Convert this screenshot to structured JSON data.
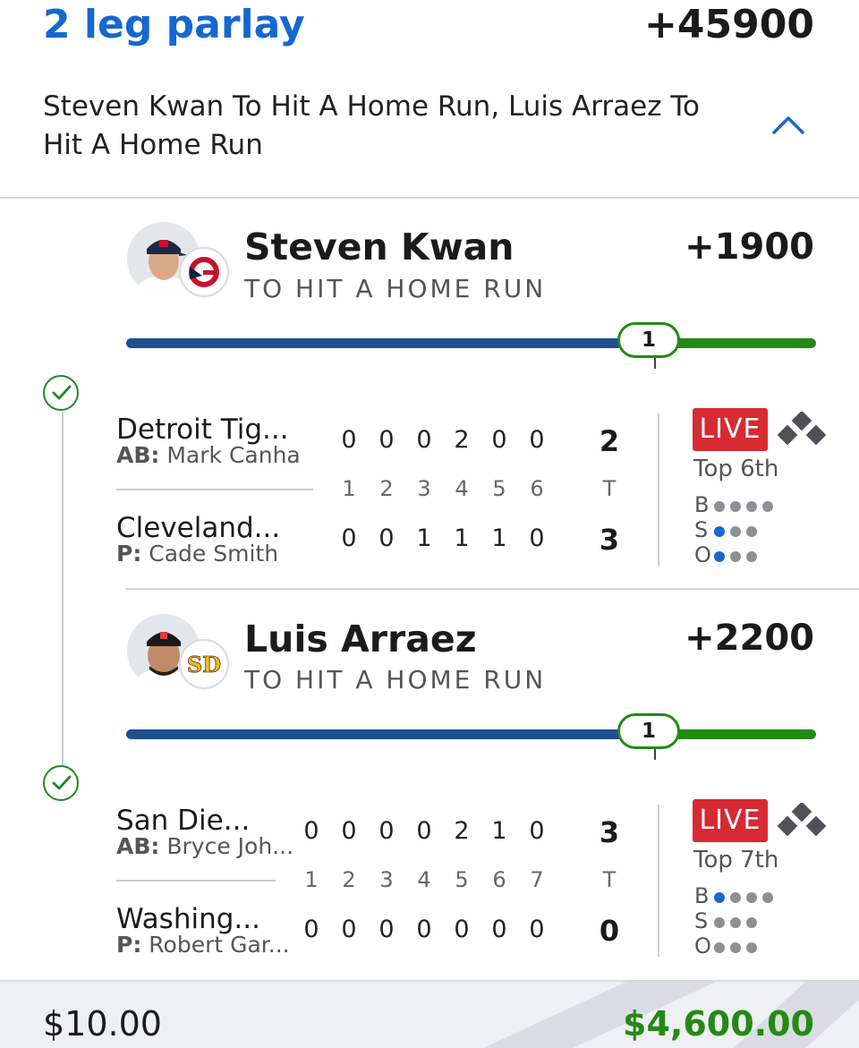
{
  "header": {
    "title": "2 leg parlay",
    "odds": "+45900",
    "description": "Steven Kwan To Hit A Home Run, Luis Arraez To Hit A Home Run"
  },
  "legs": [
    {
      "player": "Steven Kwan",
      "market": "TO HIT A HOME RUN",
      "odds": "+1900",
      "progress_value": "1",
      "progress_fraction": 0.8,
      "team_logo": "guardians-logo-icon",
      "game": {
        "away": {
          "name": "Detroit Tig...",
          "role_label": "AB:",
          "role_player": "Mark Canha",
          "innings": [
            "0",
            "0",
            "0",
            "2",
            "0",
            "0"
          ],
          "total": "2"
        },
        "home": {
          "name": "Cleveland...",
          "role_label": "P:",
          "role_player": "Cade Smith",
          "innings": [
            "0",
            "0",
            "1",
            "1",
            "1",
            "0"
          ],
          "total": "3"
        },
        "inning_numbers": [
          "1",
          "2",
          "3",
          "4",
          "5",
          "6"
        ],
        "total_header": "T",
        "status": "LIVE",
        "inning_state": "Top 6th",
        "balls_label": "B",
        "strikes_label": "S",
        "outs_label": "O",
        "balls": 0,
        "strikes": 1,
        "outs": 1
      }
    },
    {
      "player": "Luis Arraez",
      "market": "TO HIT A HOME RUN",
      "odds": "+2200",
      "progress_value": "1",
      "progress_fraction": 0.8,
      "team_logo": "padres-logo-icon",
      "game": {
        "away": {
          "name": "San Die...",
          "role_label": "AB:",
          "role_player": "Bryce Joh...",
          "innings": [
            "0",
            "0",
            "0",
            "0",
            "2",
            "1",
            "0"
          ],
          "total": "3"
        },
        "home": {
          "name": "Washing...",
          "role_label": "P:",
          "role_player": "Robert Gar...",
          "innings": [
            "0",
            "0",
            "0",
            "0",
            "0",
            "0",
            "0"
          ],
          "total": "0"
        },
        "inning_numbers": [
          "1",
          "2",
          "3",
          "4",
          "5",
          "6",
          "7"
        ],
        "total_header": "T",
        "status": "LIVE",
        "inning_state": "Top 7th",
        "balls_label": "B",
        "strikes_label": "S",
        "outs_label": "O",
        "balls": 1,
        "strikes": 0,
        "outs": 0
      }
    }
  ],
  "footer": {
    "stake": "$10.00",
    "payout": "$4,600.00"
  },
  "colors": {
    "accent_blue": "#1468d0",
    "win_green": "#238a14",
    "live_red": "#d72a33",
    "progress_blue": "#1f4f8f"
  }
}
